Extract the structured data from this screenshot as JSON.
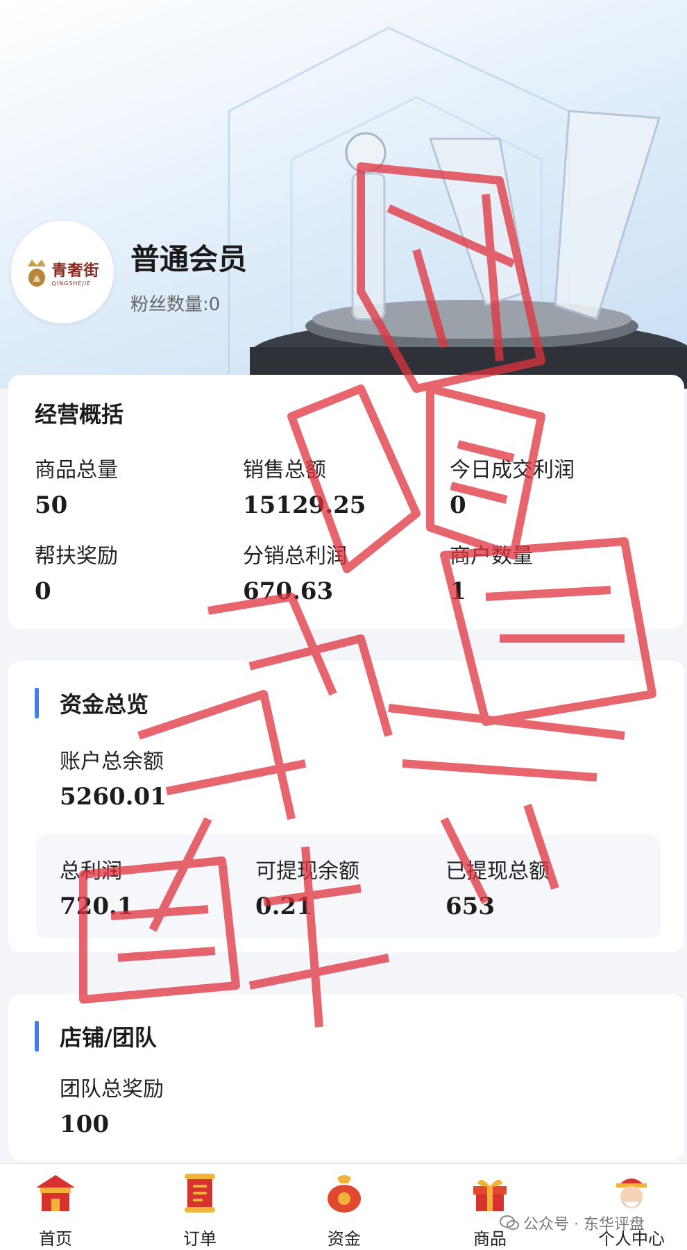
{
  "profile": {
    "logo_text": "青奢街",
    "logo_sub": "QINGSHEJIE",
    "member_level": "普通会员",
    "fans_label": "粉丝数量:0"
  },
  "overview": {
    "title": "经营概括",
    "stats": [
      {
        "label": "商品总量",
        "value": "50"
      },
      {
        "label": "销售总额",
        "value": "15129.25"
      },
      {
        "label": "今日成交利润",
        "value": "0"
      },
      {
        "label": "帮扶奖励",
        "value": "0"
      },
      {
        "label": "分销总利润",
        "value": "670.63"
      },
      {
        "label": "商户数量",
        "value": "1"
      }
    ]
  },
  "funds": {
    "title": "资金总览",
    "balance_label": "账户总余额",
    "balance_value": "5260.01",
    "stats": [
      {
        "label": "总利润",
        "value": "720.1"
      },
      {
        "label": "可提现余额",
        "value": "0.21"
      },
      {
        "label": "已提现总额",
        "value": "653"
      }
    ]
  },
  "shop": {
    "title": "店铺/团队",
    "team_label": "团队总奖励",
    "team_value": "100"
  },
  "tabbar": [
    {
      "label": "首页",
      "icon": "home-icon"
    },
    {
      "label": "订单",
      "icon": "order-scroll-icon"
    },
    {
      "label": "资金",
      "icon": "money-bag-icon"
    },
    {
      "label": "商品",
      "icon": "gift-box-icon"
    },
    {
      "label": "个人中心",
      "icon": "fortune-god-icon"
    }
  ],
  "watermark": {
    "footer": "公众号 · 东华评盘"
  },
  "colors": {
    "accent": "#3f7ff0",
    "stamp": "#e0323c"
  }
}
